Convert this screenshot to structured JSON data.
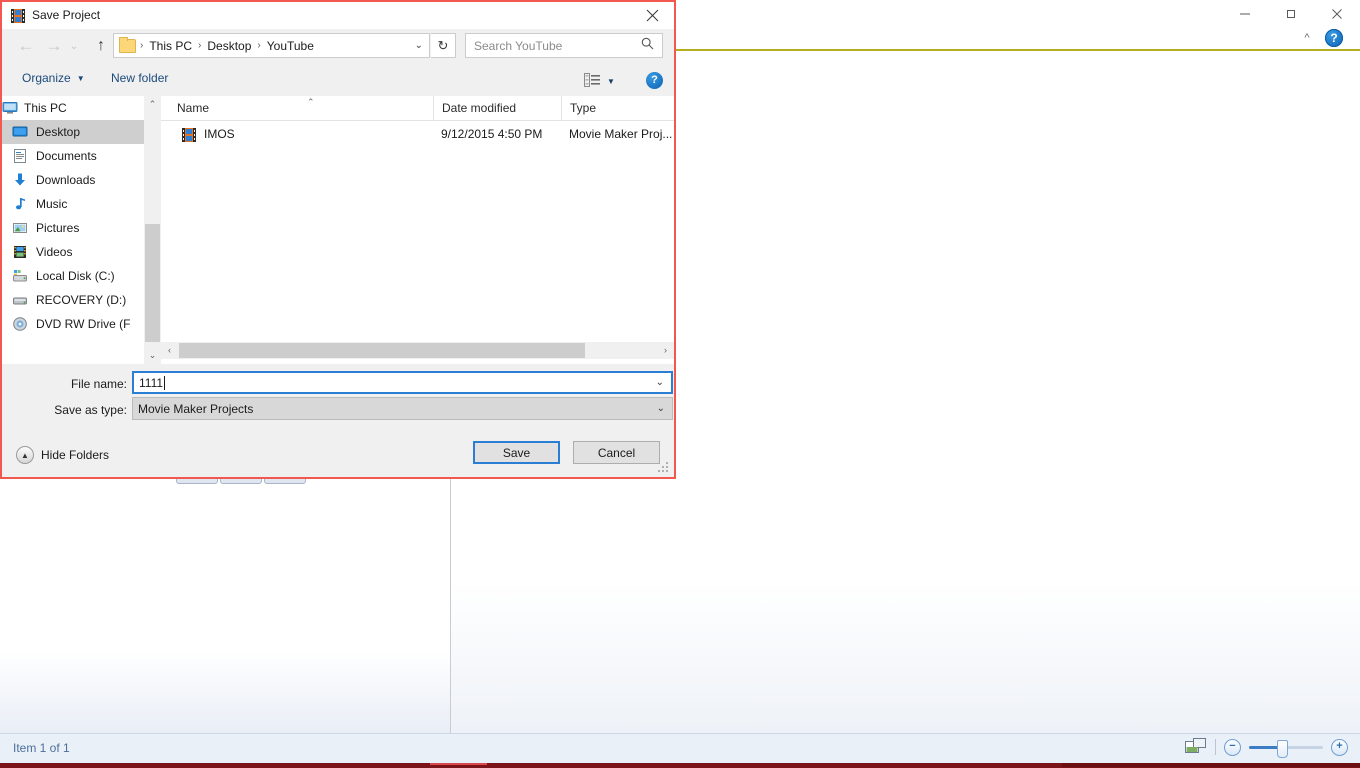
{
  "background_window": {
    "name": "movie-maker-window",
    "window_controls": [
      {
        "name": "minimize",
        "glyph": "minimize-icon"
      },
      {
        "name": "maximize",
        "glyph": "maximize-icon"
      },
      {
        "name": "close",
        "glyph": "close-icon"
      }
    ],
    "ribbon_chevron": "chevron-up-icon",
    "help_label": "?",
    "status_text": "Item 1 of 1",
    "zoom": {
      "minus_label": "−",
      "plus_label": "+",
      "preview_icon": "preview-pane-icon"
    },
    "media_controls": [
      {
        "name": "previous",
        "glyph": "⏮"
      },
      {
        "name": "play",
        "glyph": "▶"
      },
      {
        "name": "next",
        "glyph": "⏭"
      }
    ]
  },
  "dialog": {
    "title": "Save Project",
    "title_icon": "movie-maker-film-icon",
    "close_label": "✕",
    "nav": {
      "back_label": "←",
      "forward_label": "→",
      "history_label": "⌄",
      "up_label": "↑",
      "refresh_label": "↻",
      "breadcrumb": [
        "This PC",
        "Desktop",
        "YouTube"
      ],
      "breadcrumb_separator": "›",
      "address_dropdown_label": "⌄"
    },
    "search": {
      "placeholder": "Search YouTube",
      "icon": "search-icon"
    },
    "command_bar": {
      "organize_label": "Organize",
      "organize_caret": "▼",
      "new_folder_label": "New folder",
      "view_icon": "view-layout-icon",
      "view_caret": "▼",
      "help_label": "?"
    },
    "tree": {
      "items": [
        {
          "label": "This PC",
          "icon": "monitor-icon",
          "selected": false,
          "root": true
        },
        {
          "label": "Desktop",
          "icon": "desktop-icon",
          "selected": true,
          "root": false
        },
        {
          "label": "Documents",
          "icon": "documents-icon",
          "selected": false,
          "root": false
        },
        {
          "label": "Downloads",
          "icon": "downloads-icon",
          "selected": false,
          "root": false
        },
        {
          "label": "Music",
          "icon": "music-icon",
          "selected": false,
          "root": false
        },
        {
          "label": "Pictures",
          "icon": "pictures-icon",
          "selected": false,
          "root": false
        },
        {
          "label": "Videos",
          "icon": "videos-icon",
          "selected": false,
          "root": false
        },
        {
          "label": "Local Disk (C:)",
          "icon": "local-disk-icon",
          "selected": false,
          "root": false
        },
        {
          "label": "RECOVERY (D:)",
          "icon": "drive-icon",
          "selected": false,
          "root": false
        },
        {
          "label": "DVD RW Drive (F",
          "icon": "dvd-drive-icon",
          "selected": false,
          "root": false
        }
      ],
      "scroll_up_label": "⌃",
      "scroll_down_label": "⌄"
    },
    "file_list": {
      "columns": [
        "Name",
        "Date modified",
        "Type"
      ],
      "sort_indicator": "⌃",
      "rows": [
        {
          "name": "IMOS",
          "date_modified": "9/12/2015 4:50 PM",
          "type": "Movie Maker Proj...",
          "icon": "movie-maker-file-icon"
        }
      ],
      "hscroll_left_label": "‹",
      "hscroll_right_label": "›"
    },
    "form": {
      "file_name_label": "File name:",
      "file_name_value": "1111",
      "file_name_dropdown": "⌄",
      "save_as_type_label": "Save as type:",
      "save_as_type_value": "Movie Maker Projects",
      "save_as_type_dropdown": "⌄"
    },
    "footer": {
      "hide_folders_label": "Hide Folders",
      "hide_folders_icon": "▲",
      "save_label": "Save",
      "cancel_label": "Cancel"
    }
  },
  "colors": {
    "dialog_border": "#f2584f",
    "focus_blue": "#2a7fd4",
    "selection_gray": "#cfcfcf",
    "link_blue": "#1b4a7a",
    "olive_rule": "#b5ae1f",
    "status_bar": "#eaf0f8",
    "bottom_strip": "#7a1418"
  }
}
